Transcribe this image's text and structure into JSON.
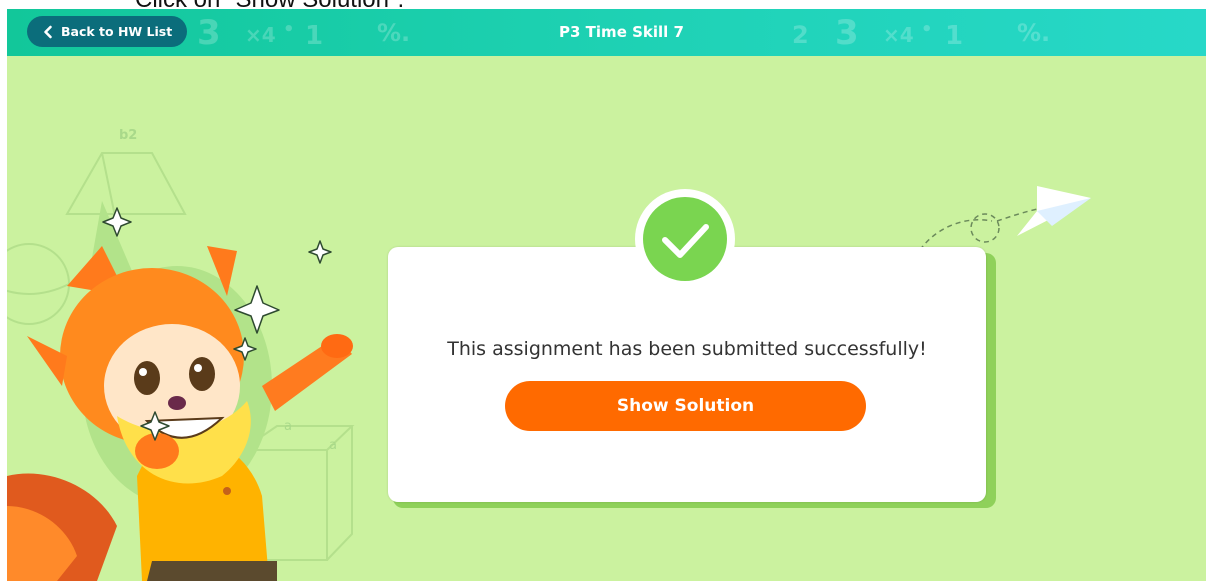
{
  "caption": "Click on \"Show Solution\".",
  "header": {
    "back_label": "Back to HW List",
    "title": "P3 Time Skill 7"
  },
  "card": {
    "message": "This assignment has been submitted successfully!",
    "button_label": "Show Solution"
  },
  "decor": {
    "header_glyphs": [
      "3",
      "×4",
      "•",
      "1",
      "%.",
      "2",
      "3",
      "×4",
      "•",
      "1",
      "%."
    ],
    "background_labels": [
      "b2",
      "a",
      "a"
    ]
  },
  "colors": {
    "header_start": "#12c79a",
    "header_end": "#27d8c8",
    "back_button": "#0b6d7b",
    "background": "#cbf29f",
    "check_green": "#7ad550",
    "button_orange": "#ff6a00"
  },
  "icons": {
    "back": "chevron-left-icon",
    "success": "check-circle-icon",
    "paper_plane": "paper-plane-icon",
    "mascot": "fox-mascot-illustration"
  }
}
